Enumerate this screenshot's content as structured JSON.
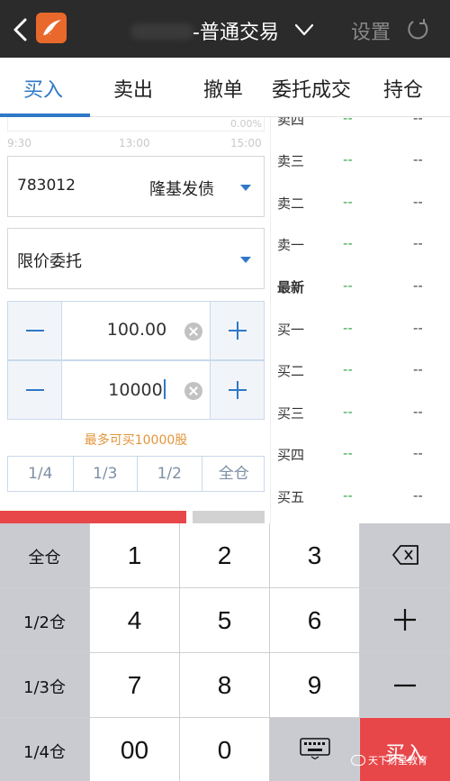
{
  "topbar": {
    "title": "-普通交易",
    "settings_label": "设置"
  },
  "tabs": [
    "买入",
    "卖出",
    "撤单",
    "委托成交",
    "持仓"
  ],
  "mini_chart": {
    "percent": "0.00%",
    "times": [
      "9:30",
      "13:00",
      "15:00"
    ]
  },
  "stock": {
    "code": "783012",
    "name": "隆基发债"
  },
  "order_type": "限价委托",
  "price_input": {
    "value": "100.00"
  },
  "quantity_input": {
    "value": "10000"
  },
  "max_hint": "最多可买10000股",
  "ratio_buttons": [
    "1/4",
    "1/3",
    "1/2",
    "全仓"
  ],
  "quote": {
    "rows": [
      {
        "label": "卖四",
        "price": "--",
        "vol": "--"
      },
      {
        "label": "卖三",
        "price": "--",
        "vol": "--"
      },
      {
        "label": "卖二",
        "price": "--",
        "vol": "--"
      },
      {
        "label": "卖一",
        "price": "--",
        "vol": "--"
      },
      {
        "label": "最新",
        "price": "--",
        "vol": "--"
      },
      {
        "label": "买一",
        "price": "--",
        "vol": "--"
      },
      {
        "label": "买二",
        "price": "--",
        "vol": "--"
      },
      {
        "label": "买三",
        "price": "--",
        "vol": "--"
      },
      {
        "label": "买四",
        "price": "--",
        "vol": "--"
      },
      {
        "label": "买五",
        "price": "--",
        "vol": "--"
      }
    ]
  },
  "keypad": {
    "left": [
      "全仓",
      "1/2仓",
      "1/3仓",
      "1/4仓"
    ],
    "digits": [
      "1",
      "2",
      "3",
      "4",
      "5",
      "6",
      "7",
      "8",
      "9",
      "00",
      "0"
    ],
    "buy_label": "买入",
    "right_icons": [
      "backspace-icon",
      "plus-icon",
      "minus-icon"
    ]
  },
  "watermark": "天下财星教育",
  "colors": {
    "accent": "#2f78c6",
    "buy_red": "#e8474a",
    "hint_orange": "#e3953b",
    "quote_green": "#3aa64b"
  }
}
